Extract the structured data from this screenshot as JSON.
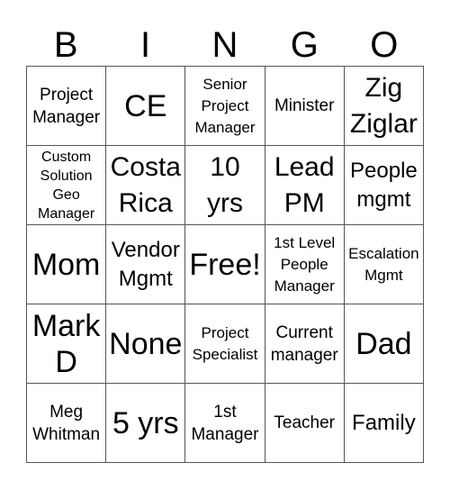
{
  "header": {
    "letters": [
      "B",
      "I",
      "N",
      "G",
      "O"
    ]
  },
  "cells": [
    [
      "Project\nManager",
      "CE",
      "Senior\nProject\nManager",
      "Minister",
      "Zig\nZiglar"
    ],
    [
      "Custom\nSolution\nGeo\nManager",
      "Costa\nRica",
      "10\nyrs",
      "Lead\nPM",
      "People\nmgmt"
    ],
    [
      "Mom",
      "Vendor\nMgmt",
      "Free!",
      "1st Level\nPeople\nManager",
      "Escalation\nMgmt"
    ],
    [
      "Mark\nD",
      "None",
      "Project\nSpecialist",
      "Current\nmanager",
      "Dad"
    ],
    [
      "Meg\nWhitman",
      "5 yrs",
      "1st\nManager",
      "Teacher",
      "Family"
    ]
  ]
}
